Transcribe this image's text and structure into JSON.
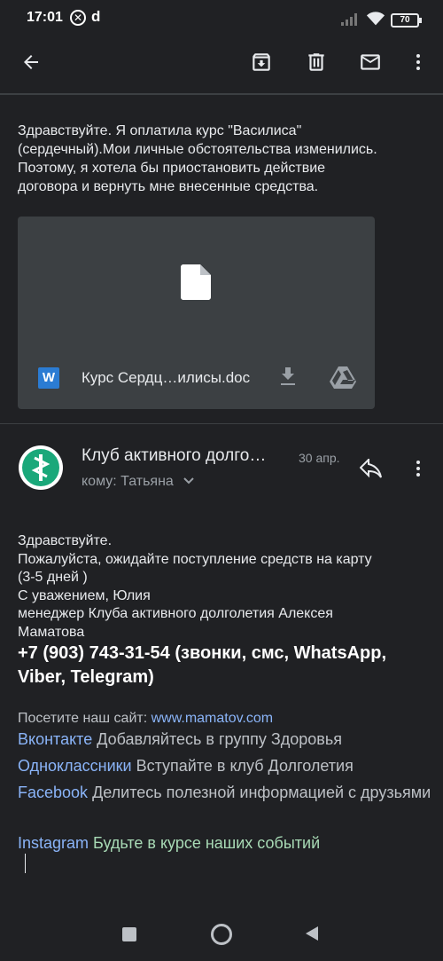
{
  "status_bar": {
    "time": "17:01",
    "extra_letter": "d",
    "battery": "70"
  },
  "toolbar": {
    "icons": [
      "back-arrow-icon",
      "archive-icon",
      "delete-icon",
      "mail-icon",
      "more-vert-icon"
    ]
  },
  "message1": {
    "body_lines": [
      "Здравствуйте. Я оплатила курс \"Василиса\"",
      "(сердечный).Мои личные обстоятельства изменились.",
      "Поэтому, я хотела бы приостановить действие",
      "договора и вернуть мне внесенные средства."
    ],
    "attachment": {
      "badge": "W",
      "filename": "Курс Сердц…илисы.doc"
    }
  },
  "message2": {
    "sender": "Клуб активного долго…",
    "date": "30 апр.",
    "to": "кому: Татьяна",
    "body_lines": [
      "Здравствуйте.",
      "Пожалуйста, ожидайте поступление средств на карту",
      "(3-5 дней )",
      "С уважением, Юлия",
      "менеджер Клуба активного долголетия Алексея",
      "Маматова"
    ],
    "phone": "+7 (903) 743-31-54 (звонки, смс, WhatsApp, Viber, Telegram)",
    "site_prefix": "Посетите наш сайт: ",
    "site_link": "www.mamatov.com",
    "social": [
      {
        "link": "Вконтакте",
        "text": " Добавляйтесь в группу Здоровья"
      },
      {
        "link": "Одноклассники",
        "text": " Вступайте в клуб Долголетия"
      },
      {
        "link": "Facebook",
        "text": " Делитесь полезной информацией с друзьями"
      },
      {
        "link": "Instagram",
        "text": " Будьте в курсе наших событий"
      }
    ]
  },
  "colors": {
    "background": "#202124",
    "link": "#8ab4f8",
    "instagram_text": "#a8dab5",
    "avatar": "#1aa87a"
  }
}
